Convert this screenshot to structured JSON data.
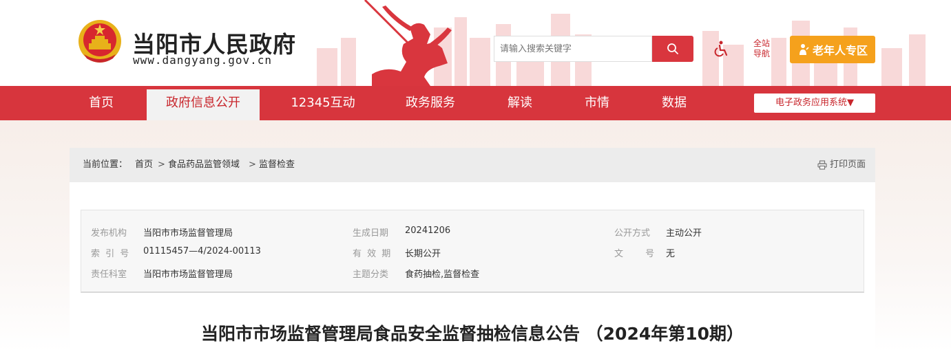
{
  "header": {
    "title": "当阳市人民政府",
    "url": "www.dangyang.gov.cn",
    "search_placeholder": "请输入搜索关键字",
    "site_nav_line1": "全站",
    "site_nav_line2": "导航",
    "elder_label": "老年人专区"
  },
  "nav": {
    "items": [
      "首页",
      "政府信息公开",
      "12345互动",
      "政务服务",
      "解读",
      "市情",
      "数据"
    ],
    "active_index": 1,
    "app_system": "电子政务应用系统▼"
  },
  "breadcrumb": {
    "prefix": "当前位置：",
    "items": [
      "首页",
      "食品药品监管领域",
      "监督检查"
    ],
    "separator": ">",
    "print_label": "打印页面"
  },
  "meta": {
    "publisher_label": "发布机构",
    "publisher": "当阳市市场监督管理局",
    "index_label": "索 引 号",
    "index": "01115457—4/2024-00113",
    "dept_label": "责任科室",
    "dept": "当阳市市场监督管理局",
    "date_label": "生成日期",
    "date": "20241206",
    "validity_label": "有 效 期",
    "validity": "长期公开",
    "topic_label": "主题分类",
    "topic": "食药抽检,监督检查",
    "open_label": "公开方式",
    "open": "主动公开",
    "docno_label": "文 号",
    "docno": "无"
  },
  "article": {
    "title": "当阳市市场监督管理局食品安全监督抽检信息公告 （2024年第10期）"
  },
  "colors": {
    "brand_red": "#d7353d",
    "elder_orange": "#f5a11c",
    "nav_active_bg": "#f2f2f2"
  },
  "icons": [
    "national-emblem",
    "search-icon",
    "accessibility-icon",
    "elder-person-icon",
    "printer-icon"
  ]
}
